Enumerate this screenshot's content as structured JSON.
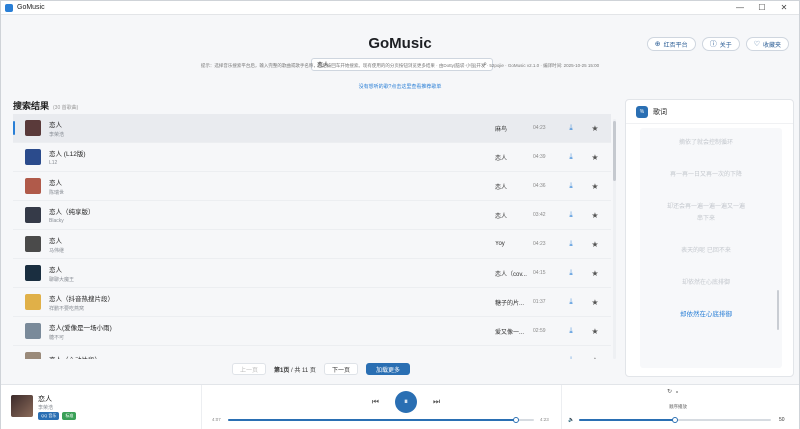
{
  "window": {
    "title": "GoMusic",
    "min": "—",
    "max": "☐",
    "close": "✕"
  },
  "header": {
    "brand": "GoMusic",
    "actions": [
      {
        "icon": "tag-icon",
        "label": "红否平台"
      },
      {
        "icon": "info-icon",
        "label": "关于"
      },
      {
        "icon": "heart-icon",
        "label": "收藏夹"
      }
    ],
    "search_value": "恋人",
    "tip": "提示：选择音乐搜索平台后，输入完整的歌曲或歌手名称，然后按回车开始搜索。现有使用的的分页按钮浏览更多结果 · 由Dotty(脑袋·小强)开发 · 52pojie · GoMusic v2.1.0 · 编译时间: 2025-10-25 15:00",
    "tip_link": "没有想听的歌?点击这里查看推荐歌单"
  },
  "results": {
    "title": "搜索结果",
    "count": "(30 首歌曲)",
    "rows": [
      {
        "title": "恋人",
        "artist": "李荣浩",
        "album": "麻鸟",
        "duration": "04:23",
        "cover": "#5a3a3a"
      },
      {
        "title": "恋人 (L12版)",
        "artist": "L12",
        "album": "恋人",
        "duration": "04:39",
        "cover": "#2b4b8c"
      },
      {
        "title": "恋人",
        "artist": "陈瑞世",
        "album": "恋人",
        "duration": "04:36",
        "cover": "#b05a4a"
      },
      {
        "title": "恋人（纯享版）",
        "artist": "Blacky",
        "album": "恋人",
        "duration": "03:42",
        "cover": "#353a48"
      },
      {
        "title": "恋人",
        "artist": "马伟继",
        "album": "Yoy",
        "duration": "04:23",
        "cover": "#4a4a4a"
      },
      {
        "title": "恋人",
        "artist": "聊聊大魔王",
        "album": "恋人（cov...",
        "duration": "04:15",
        "cover": "#1a2e40"
      },
      {
        "title": "恋人（抖音热搜片段）",
        "artist": "祥鹏不要吃燕窝",
        "album": "糖子的片...",
        "duration": "01:37",
        "cover": "#e0b048"
      },
      {
        "title": "恋人(爱像是一场小雨)",
        "artist": "糖不可",
        "album": "爱又像一...",
        "duration": "02:59",
        "cover": "#7a8a9a"
      },
      {
        "title": "恋人（心动片段）",
        "artist": "",
        "album": "",
        "duration": "",
        "cover": "#9a8a7a"
      }
    ]
  },
  "pager": {
    "prev": "上一页",
    "info_page": "第1页",
    "info_total": "/ 共 11 页",
    "next": "下一页",
    "more": "加载更多"
  },
  "lyrics": {
    "badge": "%",
    "title": "歌词",
    "lines": [
      "摘依了就会控制循环",
      "再一再一日又再一次的下降",
      "却还会再一遍一遍一遍又一遍",
      "串下来",
      "表天的呢 已回不来",
      "却依然在心底排御",
      "却依然在心底排御"
    ]
  },
  "player": {
    "title": "恋人",
    "artist": "李荣浩",
    "tag_platform": "QQ 音乐",
    "tag_quality": "标准",
    "prev": "⏮",
    "pause": "⏸",
    "next": "⏭",
    "time_current": "4:07",
    "time_total": "4:23",
    "progress": 0.94,
    "mode_label": "顺序播放",
    "volume_label": "🔈",
    "volume": 50,
    "volume_text": "50"
  }
}
